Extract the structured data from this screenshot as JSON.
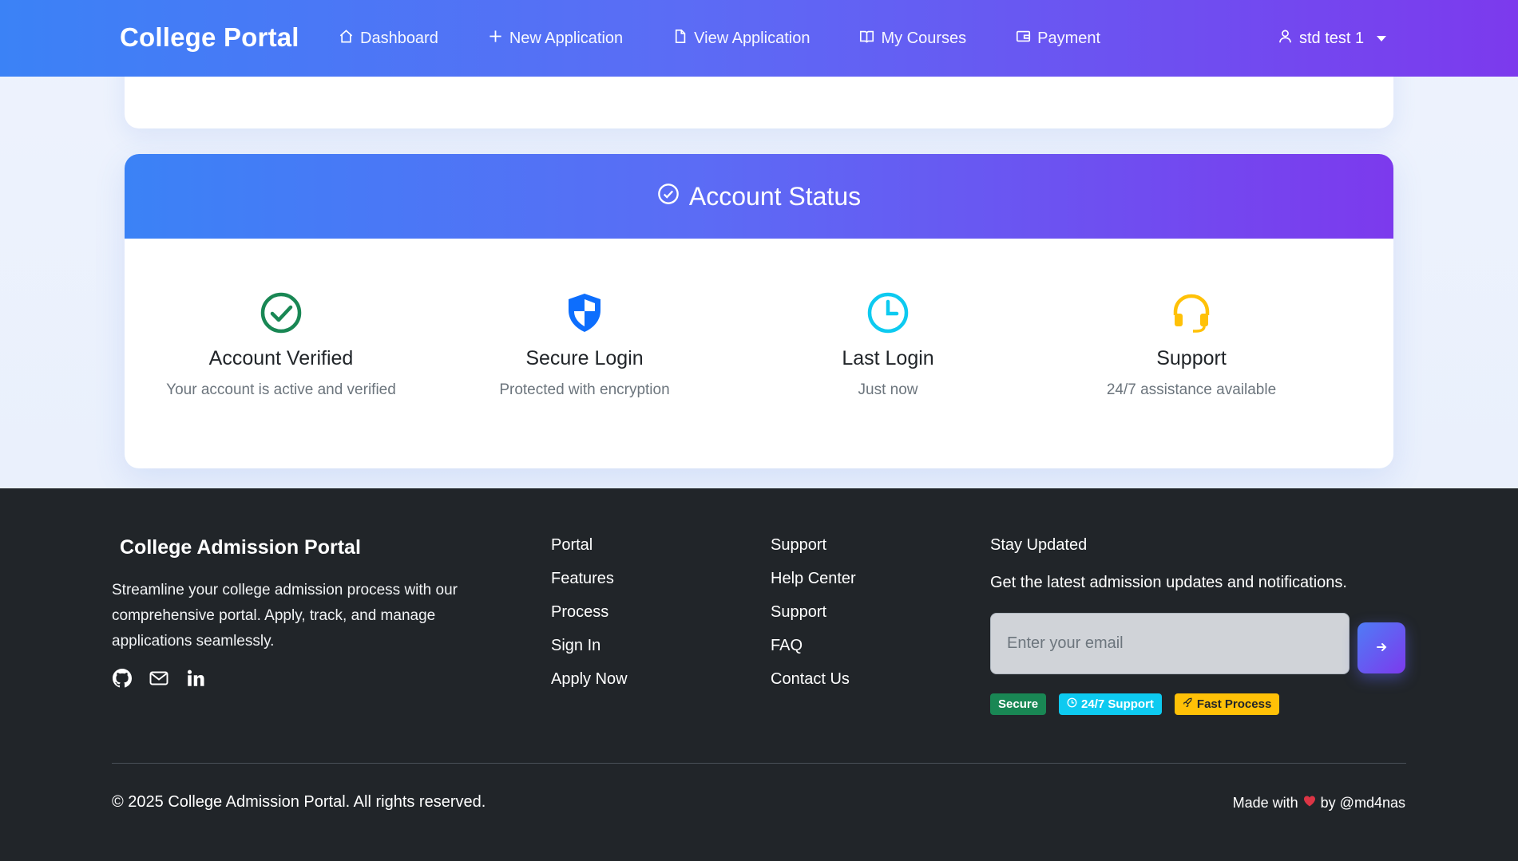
{
  "navbar": {
    "brand": "College Portal",
    "items": [
      {
        "label": "Dashboard",
        "icon": "house-icon"
      },
      {
        "label": "New Application",
        "icon": "plus-icon"
      },
      {
        "label": "View Application",
        "icon": "file-icon"
      },
      {
        "label": "My Courses",
        "icon": "book-icon"
      },
      {
        "label": "Payment",
        "icon": "wallet-icon"
      }
    ],
    "user": {
      "label": "std test 1",
      "icon": "person-icon"
    }
  },
  "status": {
    "title": "Account Status",
    "items": [
      {
        "title": "Account Verified",
        "desc": "Your account is active and verified",
        "icon": "check-circle-icon",
        "color": "#198754"
      },
      {
        "title": "Secure Login",
        "desc": "Protected with encryption",
        "icon": "shield-icon",
        "color": "#0d6efd"
      },
      {
        "title": "Last Login",
        "desc": "Just now",
        "icon": "clock-icon",
        "color": "#0dcaf0"
      },
      {
        "title": "Support",
        "desc": "24/7 assistance available",
        "icon": "headset-icon",
        "color": "#ffc107"
      }
    ]
  },
  "footer": {
    "brand": "College Admission Portal",
    "description": "Streamline your college admission process with our comprehensive portal. Apply, track, and manage applications seamlessly.",
    "socials": [
      "github-icon",
      "envelope-icon",
      "linkedin-icon"
    ],
    "portal": {
      "title": "Portal",
      "links": [
        "Features",
        "Process",
        "Sign In",
        "Apply Now"
      ]
    },
    "support": {
      "title": "Support",
      "links": [
        "Help Center",
        "Support",
        "FAQ",
        "Contact Us"
      ]
    },
    "newsletter": {
      "title": "Stay Updated",
      "text": "Get the latest admission updates and notifications.",
      "placeholder": "Enter your email",
      "badges": [
        "Secure",
        "24/7 Support",
        "Fast Process"
      ]
    },
    "copyright": "© 2025 College Admission Portal. All rights reserved.",
    "made_prefix": "Made with",
    "made_suffix": "by @md4nas"
  }
}
